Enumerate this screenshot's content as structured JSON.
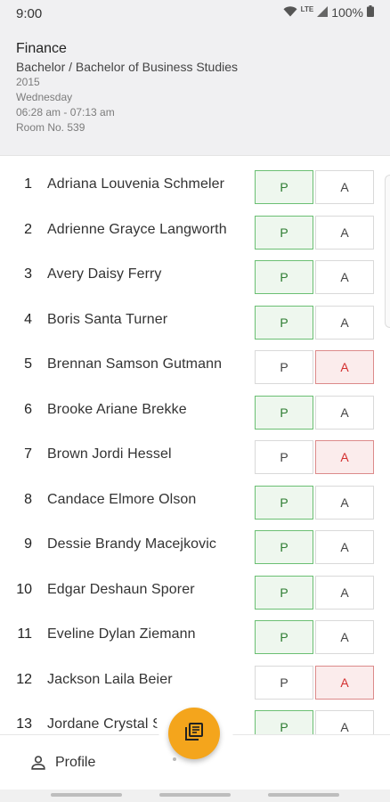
{
  "status": {
    "time": "9:00",
    "network": "LTE",
    "battery": "100%"
  },
  "class_info": {
    "subject": "Finance",
    "program": "Bachelor / Bachelor of Business Studies",
    "year": "2015",
    "day": "Wednesday",
    "time_range": "06:28 am - 07:13 am",
    "room": "Room No. 539"
  },
  "buttons": {
    "present": "P",
    "absent": "A"
  },
  "students": [
    {
      "num": "1",
      "name": "Adriana Louvenia Schmeler",
      "status": "P"
    },
    {
      "num": "2",
      "name": "Adrienne Grayce Langworth",
      "status": "P"
    },
    {
      "num": "3",
      "name": "Avery Daisy Ferry",
      "status": "P"
    },
    {
      "num": "4",
      "name": "Boris Santa Turner",
      "status": "P"
    },
    {
      "num": "5",
      "name": "Brennan Samson Gutmann",
      "status": "A"
    },
    {
      "num": "6",
      "name": "Brooke Ariane Brekke",
      "status": "P"
    },
    {
      "num": "7",
      "name": "Brown Jordi Hessel",
      "status": "A"
    },
    {
      "num": "8",
      "name": "Candace Elmore Olson",
      "status": "P"
    },
    {
      "num": "9",
      "name": "Dessie Brandy Macejkovic",
      "status": "P"
    },
    {
      "num": "10",
      "name": "Edgar Deshaun Sporer",
      "status": "P"
    },
    {
      "num": "11",
      "name": "Eveline Dylan Ziemann",
      "status": "P"
    },
    {
      "num": "12",
      "name": "Jackson Laila Beier",
      "status": "A"
    },
    {
      "num": "13",
      "name": "Jordane Crystal Schneider",
      "status": "P"
    }
  ],
  "bottom_nav": {
    "profile_label": "Profile"
  },
  "colors": {
    "present": "#2e7d32",
    "absent": "#d32f2f",
    "fab": "#f4a51c"
  },
  "icons": {
    "profile": "person-icon",
    "fab": "notebook-icon",
    "wifi": "wifi-icon",
    "signal": "signal-icon",
    "battery": "battery-icon"
  }
}
